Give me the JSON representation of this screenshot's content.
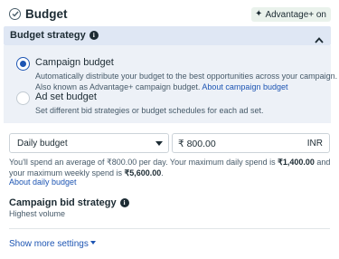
{
  "header": {
    "title": "Budget",
    "badge": "Advantage+ on",
    "badge_icon": "sparkle-icon",
    "status_icon": "check-circle-icon"
  },
  "strategy": {
    "title": "Budget strategy",
    "expanded": true,
    "options": [
      {
        "label": "Campaign budget",
        "selected": true,
        "description": "Automatically distribute your budget to the best opportunities across your campaign. Also known as Advantage+ campaign budget.",
        "link": "About campaign budget"
      },
      {
        "label": "Ad set budget",
        "selected": false,
        "description": "Set different bid strategies or budget schedules for each ad set."
      }
    ]
  },
  "budget": {
    "type_selected": "Daily budget",
    "amount": "₹ 800.00",
    "currency": "INR",
    "note_prefix": "You'll spend an average of ₹800.00 per day. Your maximum daily spend is ",
    "max_daily": "₹1,400.00",
    "note_middle": " and your maximum weekly spend is ",
    "max_weekly": "₹5,600.00",
    "note_suffix": ".",
    "about_link": "About daily budget"
  },
  "bid_strategy": {
    "title": "Campaign bid strategy",
    "value": "Highest volume"
  },
  "more_settings": "Show more settings",
  "colors": {
    "accent": "#1d55b3",
    "strategy_header_bg": "#dfe7f4",
    "strategy_panel_bg": "#edf1f7",
    "badge_bg": "#eaf2ec"
  }
}
